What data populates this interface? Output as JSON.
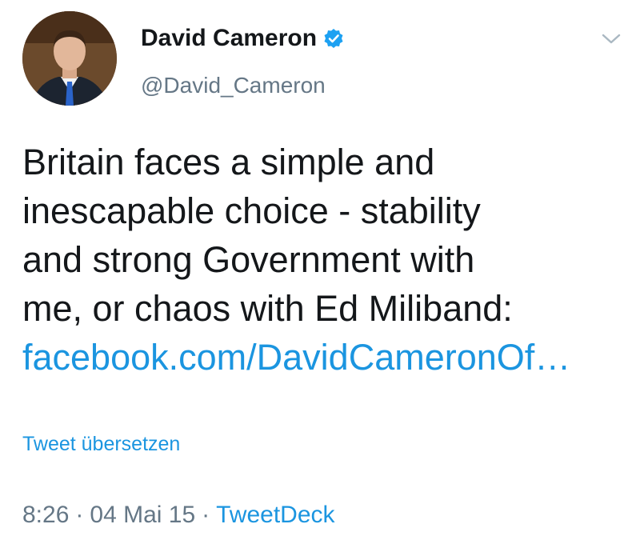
{
  "author": {
    "name": "David Cameron",
    "handle": "@David_Cameron",
    "verified": true,
    "avatar_icon": "profile-photo"
  },
  "tweet": {
    "line1": "Britain faces a simple and",
    "line2": "inescapable choice - stability",
    "line3": "and strong Government with",
    "line4": "me, or chaos with Ed Miliband:",
    "link": "facebook.com/DavidCameronOf…"
  },
  "actions": {
    "translate_label": "Tweet übersetzen",
    "menu_icon": "chevron-down-icon"
  },
  "meta": {
    "time": "8:26",
    "date": "04 Mai 15",
    "separator": "·",
    "source": "TweetDeck"
  },
  "colors": {
    "link": "#1b95e0",
    "secondary_text": "#657786",
    "primary_text": "#14171a",
    "verified_badge": "#1da1f2"
  }
}
